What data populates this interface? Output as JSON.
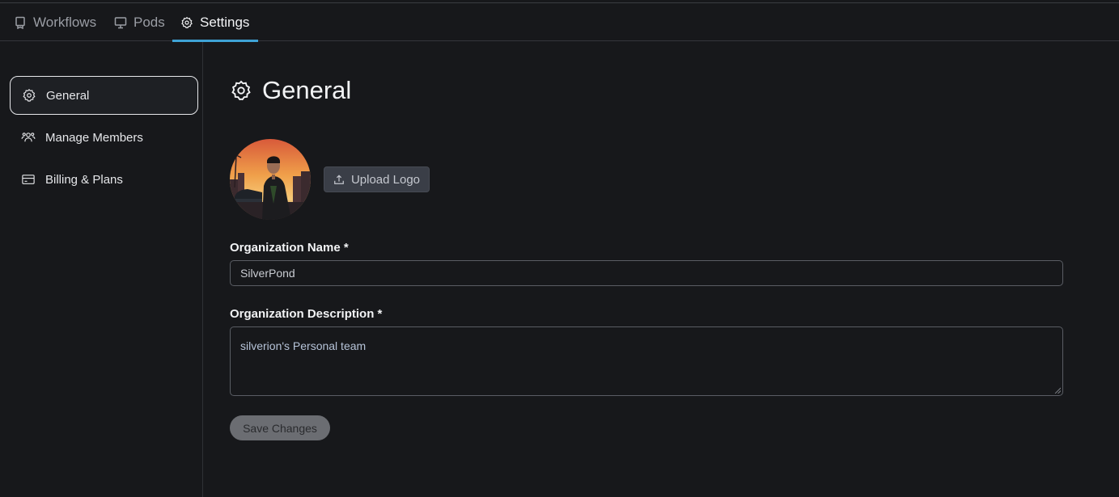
{
  "topnav": {
    "tabs": [
      {
        "label": "Workflows",
        "icon": "workflows-icon"
      },
      {
        "label": "Pods",
        "icon": "monitor-icon"
      },
      {
        "label": "Settings",
        "icon": "gear-icon",
        "active": true
      }
    ]
  },
  "sidebar": {
    "items": [
      {
        "label": "General",
        "icon": "gear-icon",
        "active": true
      },
      {
        "label": "Manage Members",
        "icon": "users-icon"
      },
      {
        "label": "Billing & Plans",
        "icon": "credit-card-icon"
      }
    ]
  },
  "main": {
    "title": "General",
    "upload_label": "Upload Logo",
    "org_name_label": "Organization Name *",
    "org_name_value": "SilverPond",
    "org_desc_label": "Organization Description *",
    "org_desc_value": "silverion's Personal team",
    "save_label": "Save Changes"
  },
  "colors": {
    "background": "#17181b",
    "accent": "#3fa3d6",
    "upload_button": "#3a3e47",
    "save_button_disabled": "#6b6d72"
  }
}
